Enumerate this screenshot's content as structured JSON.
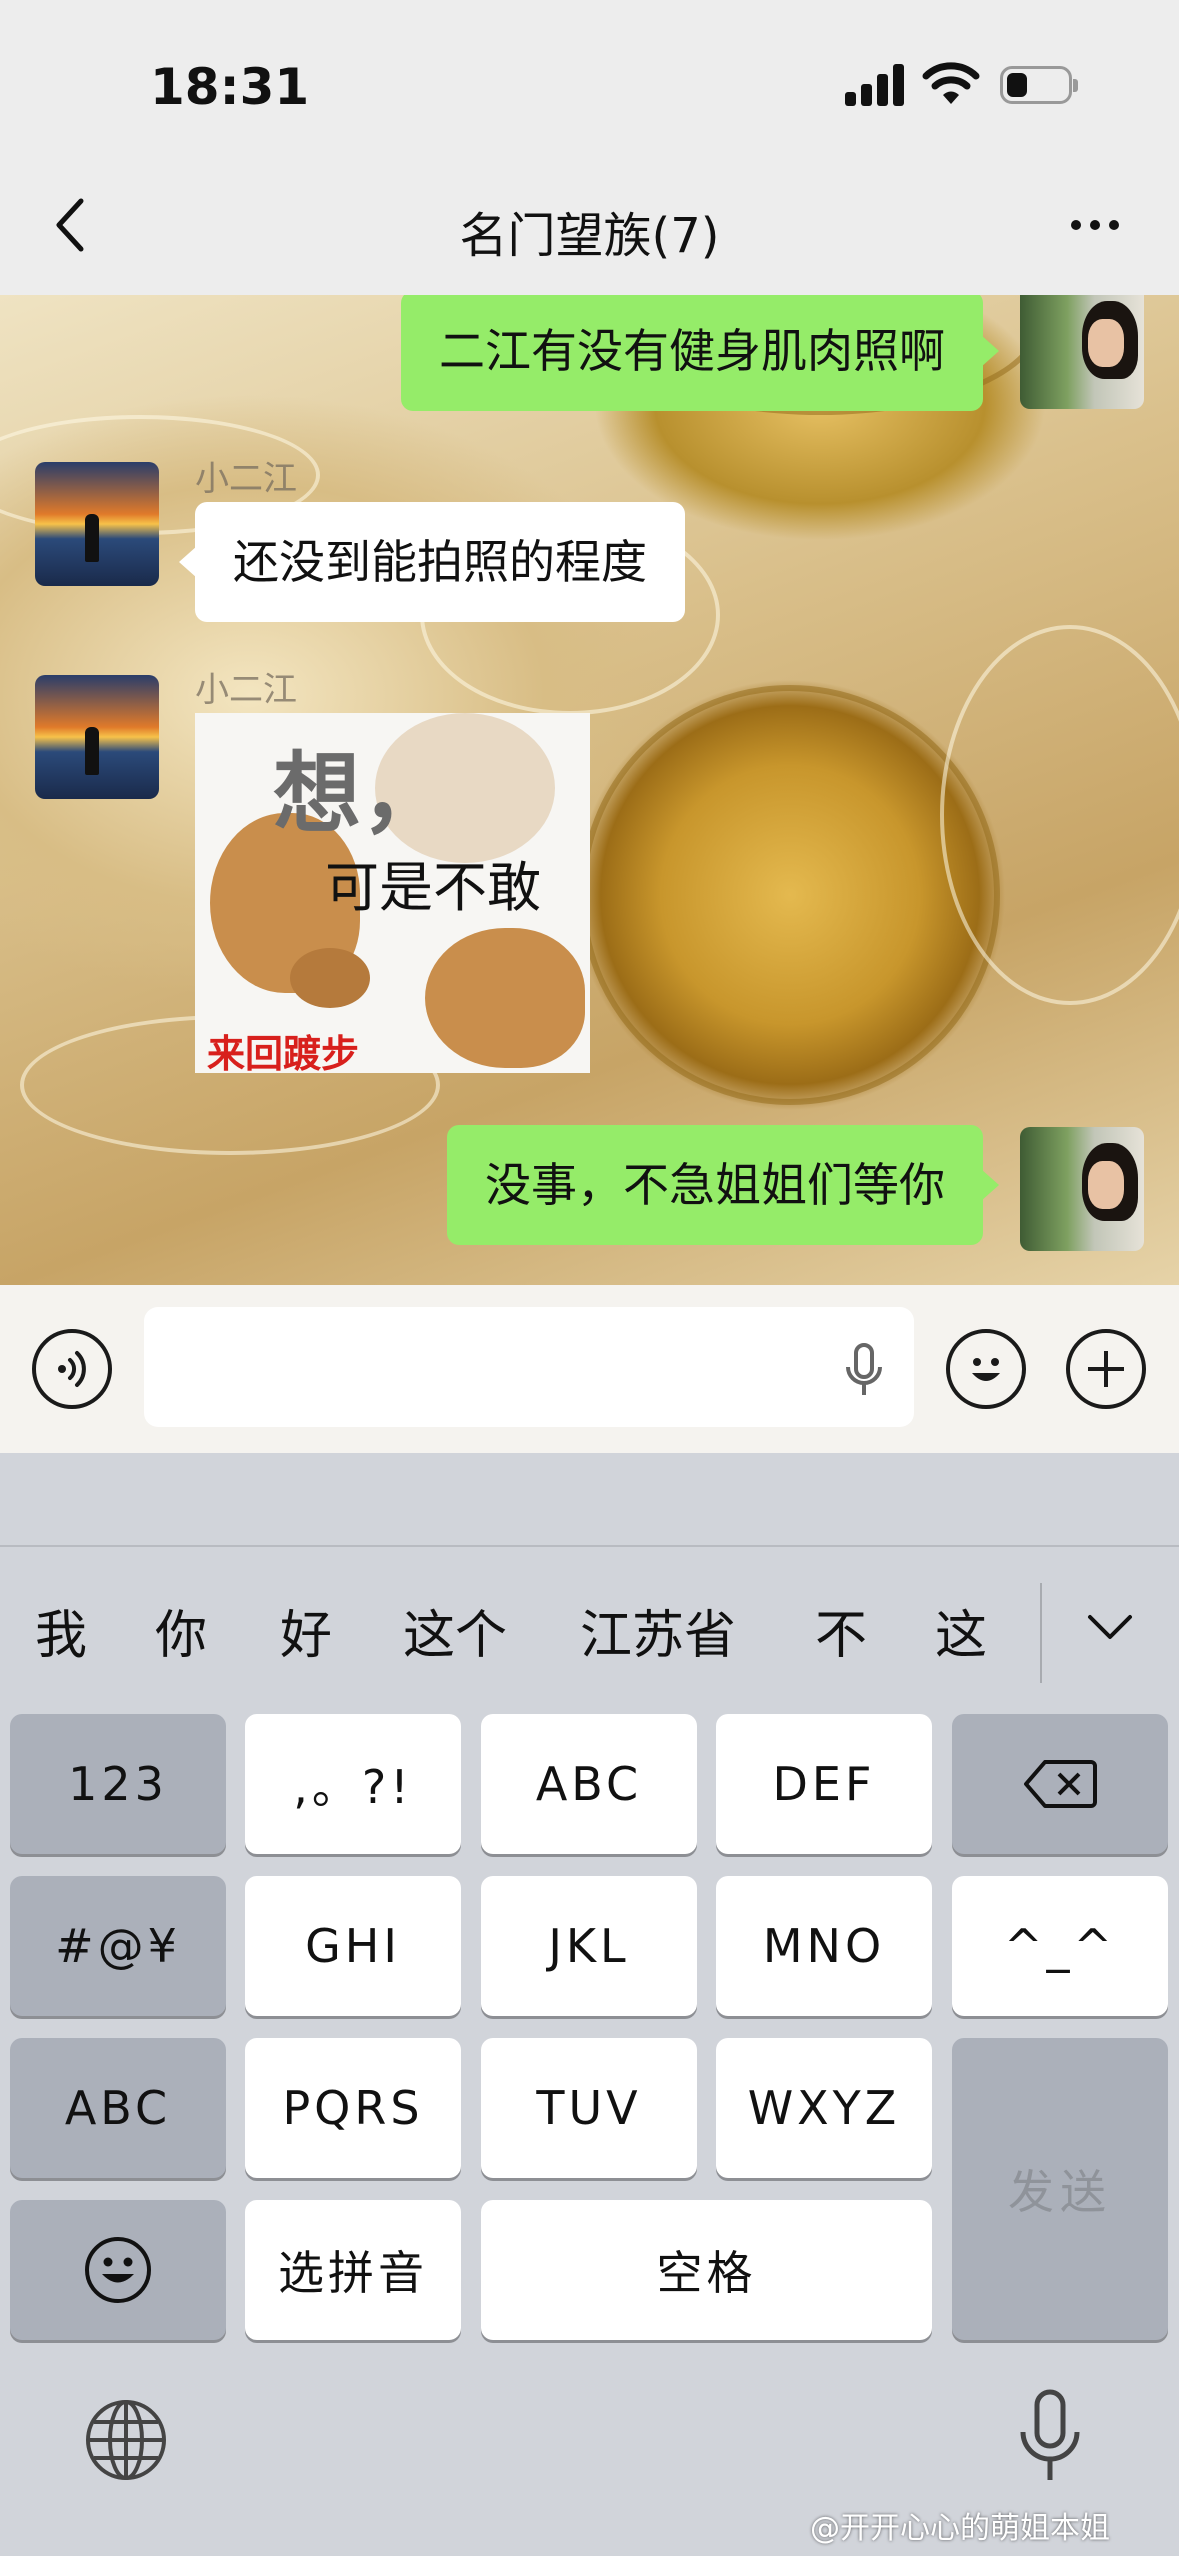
{
  "status_bar": {
    "time": "18:31"
  },
  "nav": {
    "title": "名门望族(7)"
  },
  "messages": [
    {
      "side": "right",
      "text": "二江有没有健身肌肉照啊"
    },
    {
      "side": "left",
      "sender": "小二江",
      "text": "还没到能拍照的程度"
    },
    {
      "side": "left",
      "sender": "小二江",
      "type": "sticker",
      "sticker_text_big": "想，",
      "sticker_text_mid": "可是不敢",
      "sticker_text_red": "来回踱步"
    },
    {
      "side": "right",
      "text": "没事，不急姐姐们等你"
    }
  ],
  "input_bar": {
    "placeholder": ""
  },
  "keyboard": {
    "candidates": [
      "我",
      "你",
      "好",
      "这个",
      "江苏省",
      "不",
      "这"
    ],
    "keys": {
      "num": "123",
      "punct": ",。?!",
      "abc": "ABC",
      "def": "DEF",
      "symbols": "#@¥",
      "ghi": "GHI",
      "jkl": "JKL",
      "mno": "MNO",
      "emoticon": "^_^",
      "abc_switch": "ABC",
      "pqrs": "PQRS",
      "tuv": "TUV",
      "wxyz": "WXYZ",
      "send": "发送",
      "pinyin": "选拼音",
      "space": "空格"
    }
  },
  "watermark": "@开开心心的萌姐本姐",
  "colors": {
    "green_bubble": "#95ec69",
    "keyboard_bg": "#d1d4da",
    "nav_bg": "#ededed"
  }
}
